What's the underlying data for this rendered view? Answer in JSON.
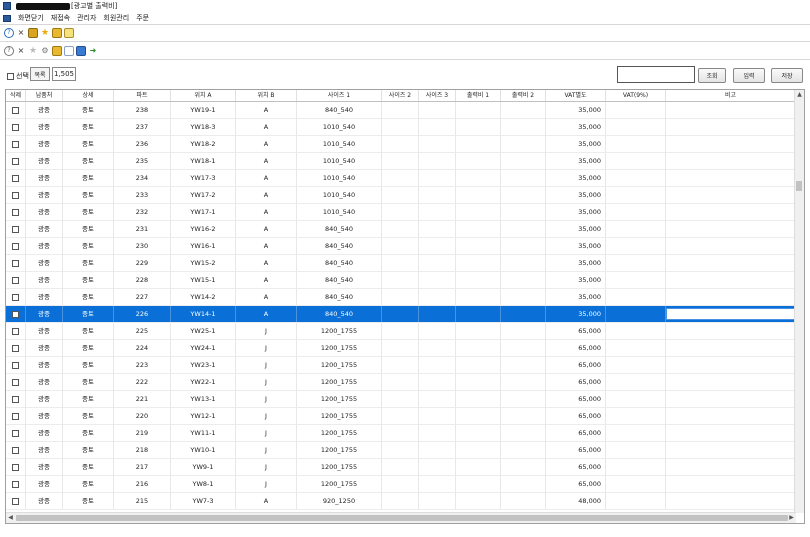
{
  "window": {
    "title": "[광고별 출력비]"
  },
  "menu": [
    "화면닫기",
    "재접속",
    "관리자",
    "회원관리",
    "주문"
  ],
  "toolbar1": [
    "help-icon",
    "close-icon",
    "lock-icon",
    "star-icon",
    "folder-icon",
    "note-icon"
  ],
  "toolbar2": [
    "help-icon",
    "close-icon",
    "star-icon",
    "gear-icon",
    "folder-icon",
    "document-icon",
    "image-icon",
    "arrow-icon"
  ],
  "controls": {
    "select_label": "선택",
    "list_label": "목록",
    "count": "1,505",
    "search_value": "",
    "btn_search": "조회",
    "btn_input": "입력",
    "btn_save": "저장"
  },
  "columns": [
    "삭제",
    "납품처",
    "상세",
    "파트",
    "위치 A",
    "위치 B",
    "사이즈 1",
    "사이즈 2",
    "사이즈 3",
    "출력비 1",
    "출력비 2",
    "VAT별도",
    "VAT(9%)",
    "비고"
  ],
  "rows": [
    [
      "광중",
      "중토",
      "238",
      "YW19-1",
      "A",
      "840_540",
      "35,000"
    ],
    [
      "광중",
      "중토",
      "237",
      "YW18-3",
      "A",
      "1010_540",
      "35,000"
    ],
    [
      "광중",
      "중토",
      "236",
      "YW18-2",
      "A",
      "1010_540",
      "35,000"
    ],
    [
      "광중",
      "중토",
      "235",
      "YW18-1",
      "A",
      "1010_540",
      "35,000"
    ],
    [
      "광중",
      "중토",
      "234",
      "YW17-3",
      "A",
      "1010_540",
      "35,000"
    ],
    [
      "광중",
      "중토",
      "233",
      "YW17-2",
      "A",
      "1010_540",
      "35,000"
    ],
    [
      "광중",
      "중토",
      "232",
      "YW17-1",
      "A",
      "1010_540",
      "35,000"
    ],
    [
      "광중",
      "중토",
      "231",
      "YW16-2",
      "A",
      "840_540",
      "35,000"
    ],
    [
      "광중",
      "중토",
      "230",
      "YW16-1",
      "A",
      "840_540",
      "35,000"
    ],
    [
      "광중",
      "중토",
      "229",
      "YW15-2",
      "A",
      "840_540",
      "35,000"
    ],
    [
      "광중",
      "중토",
      "228",
      "YW15-1",
      "A",
      "840_540",
      "35,000"
    ],
    [
      "광중",
      "중토",
      "227",
      "YW14-2",
      "A",
      "840_540",
      "35,000"
    ],
    [
      "광중",
      "중토",
      "226",
      "YW14-1",
      "A",
      "840_540",
      "35,000"
    ],
    [
      "광중",
      "중토",
      "225",
      "YW25-1",
      "J",
      "1200_1755",
      "65,000"
    ],
    [
      "광중",
      "중토",
      "224",
      "YW24-1",
      "J",
      "1200_1755",
      "65,000"
    ],
    [
      "광중",
      "중토",
      "223",
      "YW23-1",
      "J",
      "1200_1755",
      "65,000"
    ],
    [
      "광중",
      "중토",
      "222",
      "YW22-1",
      "J",
      "1200_1755",
      "65,000"
    ],
    [
      "광중",
      "중토",
      "221",
      "YW13-1",
      "J",
      "1200_1755",
      "65,000"
    ],
    [
      "광중",
      "중토",
      "220",
      "YW12-1",
      "J",
      "1200_1755",
      "65,000"
    ],
    [
      "광중",
      "중토",
      "219",
      "YW11-1",
      "J",
      "1200_1755",
      "65,000"
    ],
    [
      "광중",
      "중토",
      "218",
      "YW10-1",
      "J",
      "1200_1755",
      "65,000"
    ],
    [
      "광중",
      "중토",
      "217",
      "YW9-1",
      "J",
      "1200_1755",
      "65,000"
    ],
    [
      "광중",
      "중토",
      "216",
      "YW8-1",
      "J",
      "1200_1755",
      "65,000"
    ],
    [
      "광중",
      "중토",
      "215",
      "YW7-3",
      "A",
      "920_1250",
      "48,000"
    ]
  ],
  "selected_row_index": 12
}
